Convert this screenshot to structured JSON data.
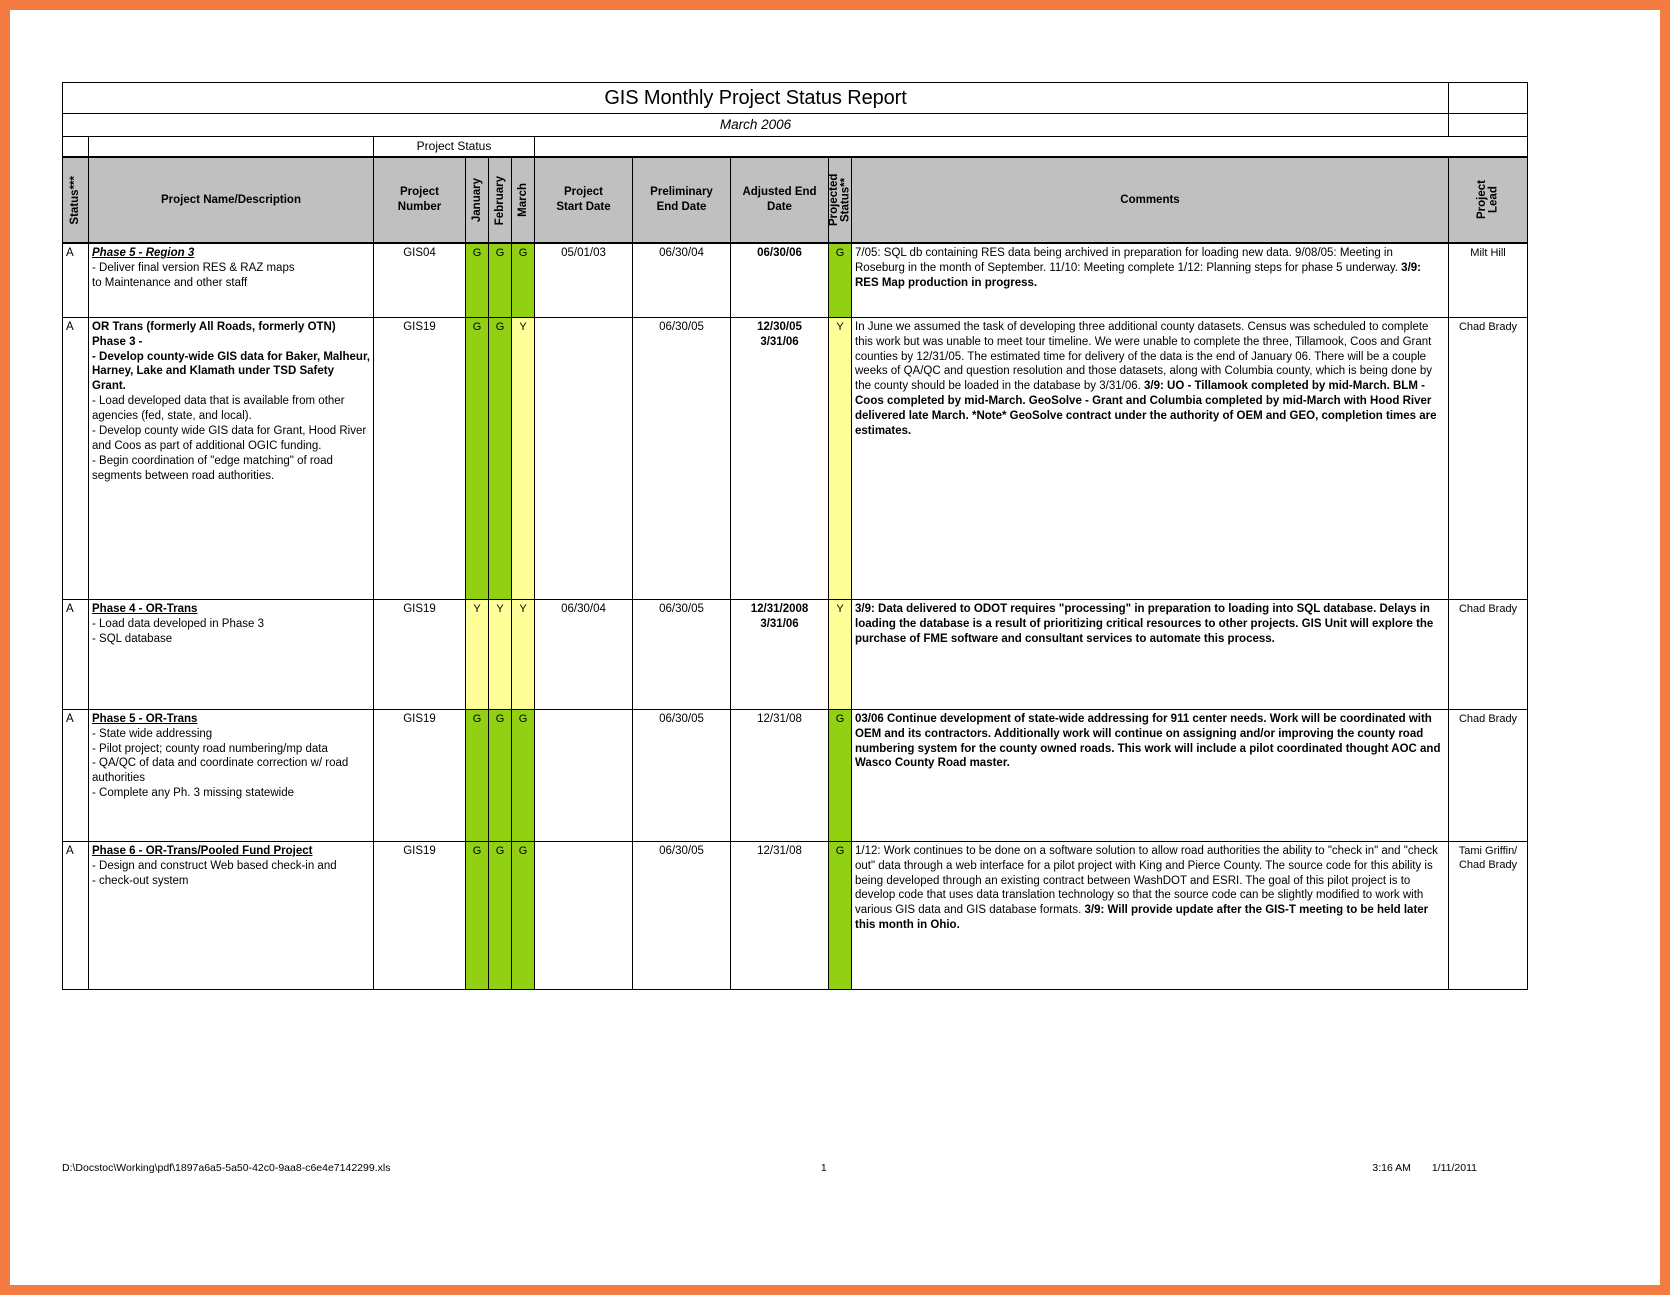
{
  "report": {
    "title": "GIS Monthly Project Status Report",
    "subtitle": "March 2006",
    "group_header": "Project Status"
  },
  "columns": {
    "status": "Status***",
    "name": "Project Name/Description",
    "number": "Project\nNumber",
    "number_l1": "Project",
    "number_l2": "Number",
    "january": "January",
    "february": "February",
    "march": "March",
    "start_l1": "Project",
    "start_l2": "Start Date",
    "prelim_l1": "Preliminary",
    "prelim_l2": "End Date",
    "adjusted_l1": "Adjusted End",
    "adjusted_l2": "Date",
    "projected": "Projected Status**",
    "comments": "Comments",
    "lead": "Project Lead"
  },
  "colors": {
    "green": "#92d014",
    "yellow": "#ffff99",
    "header_gray": "#c0c0c0",
    "scan_border": "#f47b42"
  },
  "rows": [
    {
      "status": "A",
      "title": "Phase 5 - Region 3",
      "title_style": "italic-underline",
      "desc": [
        " - Deliver final version RES & RAZ maps",
        "to Maintenance and other staff"
      ],
      "number": "GIS04",
      "january": "G",
      "february": "G",
      "march": "G",
      "jan_color": "green",
      "feb_color": "green",
      "mar_color": "green",
      "start_date": "05/01/03",
      "prelim_end": "06/30/04",
      "adjusted_end": [
        "06/30/06"
      ],
      "adjusted_bold": true,
      "projected": "G",
      "projected_color": "green",
      "comments_plain": "7/05: SQL db containing RES data being archived in preparation for loading new data.  9/08/05:  Meeting in Roseburg in the month of September.  11/10: Meeting complete 1/12: Planning steps for phase 5 underway.  ",
      "comments_bold": "3/9: RES Map production in progress.",
      "lead": "Milt Hill"
    },
    {
      "status": "A",
      "title": "OR Trans (formerly All Roads, formerly OTN)",
      "title_style": "bold",
      "subtitle": "Phase 3 -",
      "desc": [
        "- Develop county-wide GIS data for Baker, Malheur, Harney, Lake and Klamath under TSD Safety Grant.",
        "-  Load developed data that is available from other agencies (fed, state, and local).",
        " -  Develop county wide GIS data for Grant, Hood River and Coos as part of additional OGIC funding.",
        "-  Begin coordination of \"edge matching\" of road segments between road authorities."
      ],
      "number": "GIS19",
      "january": "G",
      "february": "G",
      "march": "Y",
      "jan_color": "green",
      "feb_color": "green",
      "mar_color": "yellow",
      "start_date": "",
      "prelim_end": "06/30/05",
      "adjusted_end": [
        "12/30/05",
        "3/31/06"
      ],
      "adjusted_bold": true,
      "projected": "Y",
      "projected_color": "yellow",
      "comments_plain": "In June we assumed the task of developing three additional  county datasets. Census was scheduled to complete this work but was unable to meet tour timeline. We were unable to complete the three, Tillamook, Coos and Grant counties by 12/31/05. The estimated time for delivery of the data is the end of January 06. There will be a couple weeks of QA/QC and question resolution and those datasets, along with Columbia county, which is being done by the county should be loaded in the database by 3/31/06.  ",
      "comments_bold": "3/9: UO - Tillamook completed by mid-March. BLM - Coos completed by mid-March. GeoSolve - Grant and Columbia completed by mid-March with Hood River delivered late March. *Note* GeoSolve contract under the authority of OEM and GEO, completion times are estimates.",
      "lead": "Chad Brady"
    },
    {
      "status": "A",
      "title": "Phase 4 - OR-Trans",
      "title_style": "bold-underline",
      "desc": [
        " - Load data developed in Phase 3",
        " - SQL database"
      ],
      "number": "GIS19",
      "january": "Y",
      "february": "Y",
      "march": "Y",
      "jan_color": "yellow",
      "feb_color": "yellow",
      "mar_color": "yellow",
      "start_date": "06/30/04",
      "prelim_end": "06/30/05",
      "adjusted_end": [
        "12/31/2008",
        "3/31/06"
      ],
      "adjusted_bold": true,
      "projected": "Y",
      "projected_color": "yellow",
      "comments_plain": "",
      "comments_bold": "3/9: Data delivered to ODOT requires \"processing\" in preparation to loading into SQL database. Delays in loading the database is a result of prioritizing critical resources to other projects. GIS Unit will explore the purchase of FME software and consultant services to automate this process.",
      "lead": "Chad Brady"
    },
    {
      "status": "A",
      "title": " Phase 5 - OR-Trans",
      "title_style": "bold-underline",
      "desc": [
        " - State wide addressing",
        " - Pilot project; county road numbering/mp data",
        " - QA/QC of data and coordinate correction w/ road authorities",
        " - Complete any Ph. 3 missing statewide"
      ],
      "number": "GIS19",
      "january": "G",
      "february": "G",
      "march": "G",
      "jan_color": "green",
      "feb_color": "green",
      "mar_color": "green",
      "start_date": "",
      "prelim_end": "06/30/05",
      "adjusted_end": [
        "12/31/08"
      ],
      "adjusted_bold": false,
      "projected": "G",
      "projected_color": "green",
      "comments_plain": "",
      "comments_bold": "03/06 Continue development of state-wide addressing for 911 center needs. Work will be coordinated with OEM and its contractors.  Additionally work will continue on assigning and/or improving the county road numbering system for the county owned roads.  This work will include a pilot coordinated thought AOC and Wasco County Road master.",
      "lead": "Chad Brady"
    },
    {
      "status": "A",
      "title": "Phase 6 - OR-Trans/Pooled Fund Project ",
      "title_style": "bold-underline",
      "desc": [
        " - Design and construct Web based check-in and",
        " - check-out system"
      ],
      "number": "GIS19",
      "january": "G",
      "february": "G",
      "march": "G",
      "jan_color": "green",
      "feb_color": "green",
      "mar_color": "green",
      "start_date": "",
      "prelim_end": "06/30/05",
      "adjusted_end": [
        "12/31/08"
      ],
      "adjusted_bold": false,
      "projected": "G",
      "projected_color": "green",
      "comments_plain": "1/12: Work continues to be done on a software solution to allow road authorities the ability to \"check in\" and \"check out\" data through a web interface for a pilot project with King and Pierce County. The source code for this ability is being developed through an existing contract between WashDOT and ESRI. The goal of this pilot project is to develop code that uses data translation technology so that the source code can be slightly modified to work with various GIS data and GIS database formats.  ",
      "comments_bold": "3/9: Will provide update after the GIS-T meeting to be held later this month in Ohio.",
      "lead": "Tami Griffin/ Chad Brady"
    }
  ],
  "footer": {
    "path": "D:\\Docstoc\\Working\\pdf\\1897a6a5-5a50-42c0-9aa8-c6e4e7142299.xls",
    "page": "1",
    "time": "3:16 AM",
    "date": "1/11/2011"
  }
}
